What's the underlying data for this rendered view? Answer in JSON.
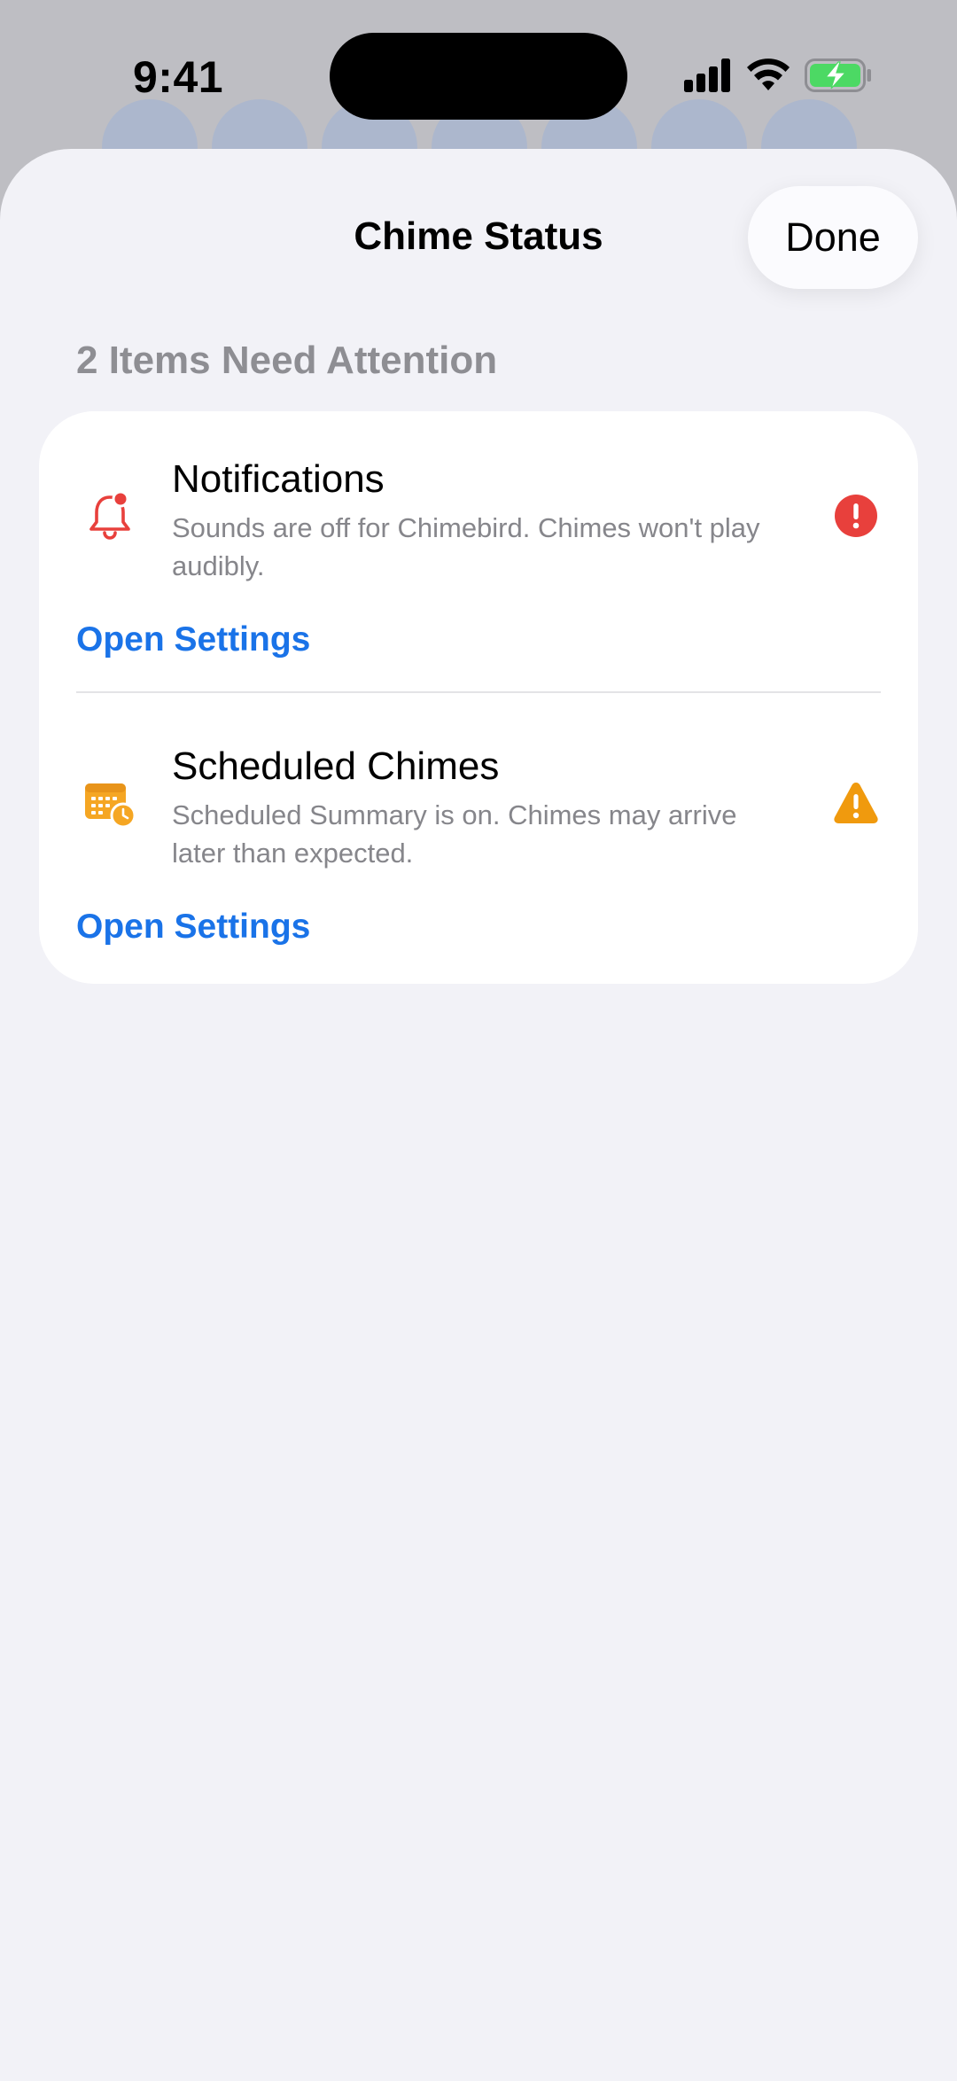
{
  "status_bar": {
    "time": "9:41"
  },
  "sheet": {
    "title": "Chime Status",
    "done_label": "Done",
    "section_header": "2 Items Need Attention"
  },
  "items": [
    {
      "title": "Notifications",
      "description": "Sounds are off for Chimebird. Chimes won't play audibly.",
      "action_label": "Open Settings",
      "icon": "bell-icon",
      "status_icon": "error-icon",
      "status_color": "#e8403c"
    },
    {
      "title": "Scheduled Chimes",
      "description": "Scheduled Summary is on. Chimes may arrive later than expected.",
      "action_label": "Open Settings",
      "icon": "calendar-clock-icon",
      "status_icon": "warning-icon",
      "status_color": "#f09a0e"
    }
  ],
  "colors": {
    "accent": "#1a73e8",
    "error": "#e8403c",
    "warning": "#f09a0e",
    "sheet_background": "#f2f2f7",
    "battery_green": "#4cd964"
  }
}
